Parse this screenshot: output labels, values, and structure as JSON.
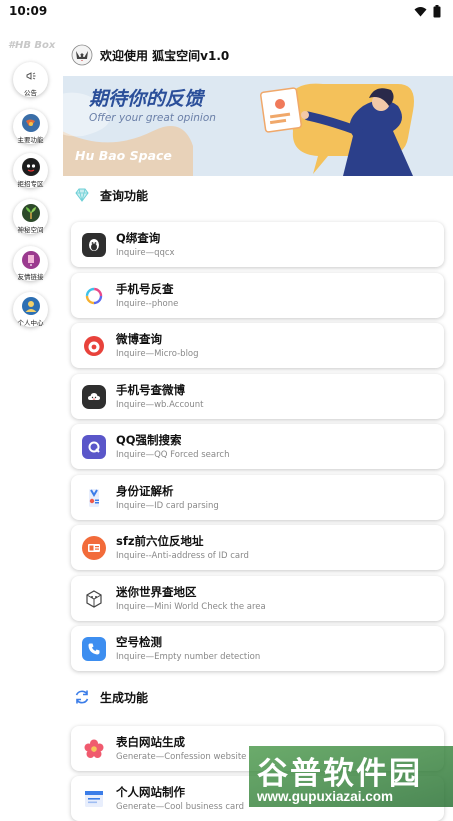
{
  "status": {
    "time": "10:09"
  },
  "sidebar": {
    "brand": "#HB Box",
    "items": [
      {
        "label": "公告",
        "icon": "megaphone-icon"
      },
      {
        "label": "主要功能",
        "icon": "globe-icon"
      },
      {
        "label": "拒招专区",
        "icon": "mascot-icon"
      },
      {
        "label": "神秘空间",
        "icon": "plant-icon"
      },
      {
        "label": "友情链接",
        "icon": "phone-link-icon"
      },
      {
        "label": "个人中心",
        "icon": "person-icon"
      }
    ]
  },
  "header": {
    "welcome": "欢迎使用 狐宝空间v1.0"
  },
  "banner": {
    "title": "期待你的反馈",
    "subtitle": "Offer your great opinion",
    "brand": "Hu Bao Space"
  },
  "sections": [
    {
      "title": "查询功能",
      "icon": "diamond-icon"
    },
    {
      "title": "生成功能",
      "icon": "refresh-icon"
    }
  ],
  "query_items": [
    {
      "title": "Q绑查询",
      "subtitle": "Inquire—qqcx",
      "icon": "qq-penguin-icon",
      "color": "#333333"
    },
    {
      "title": "手机号反查",
      "subtitle": "Inquire--phone",
      "icon": "ring-icon",
      "color": "#5b6cf0"
    },
    {
      "title": "微博查询",
      "subtitle": "Inquire—Micro-blog",
      "icon": "weibo-icon",
      "color": "#e8423b"
    },
    {
      "title": "手机号查微博",
      "subtitle": "Inquire—wb.Account",
      "icon": "cloud-icon",
      "color": "#333333"
    },
    {
      "title": "QQ强制搜索",
      "subtitle": "Inquire—QQ Forced search",
      "icon": "q-icon",
      "color": "#5a56c9"
    },
    {
      "title": "身份证解析",
      "subtitle": "Inquire—ID card parsing",
      "icon": "id-badge-icon",
      "color": "#3b7de8"
    },
    {
      "title": "sfz前六位反地址",
      "subtitle": "Inquire--Anti-address of ID card",
      "icon": "card-icon",
      "color": "#f26b3a"
    },
    {
      "title": "迷你世界查地区",
      "subtitle": "Inquire—Mini World Check the area",
      "icon": "block-icon",
      "color": "#444444"
    },
    {
      "title": "空号检测",
      "subtitle": "Inquire—Empty number detection",
      "icon": "phone-icon",
      "color": "#3d8ef0"
    }
  ],
  "generate_items": [
    {
      "title": "表白网站生成",
      "subtitle": "Generate—Confession website",
      "icon": "flower-icon",
      "color": "#f05a6e"
    },
    {
      "title": "个人网站制作",
      "subtitle": "Generate—Cool business card",
      "icon": "web-card-icon",
      "color": "#3b7de8"
    }
  ],
  "watermark": {
    "text": "谷普软件园",
    "url": "www.gupuxiazai.com"
  }
}
